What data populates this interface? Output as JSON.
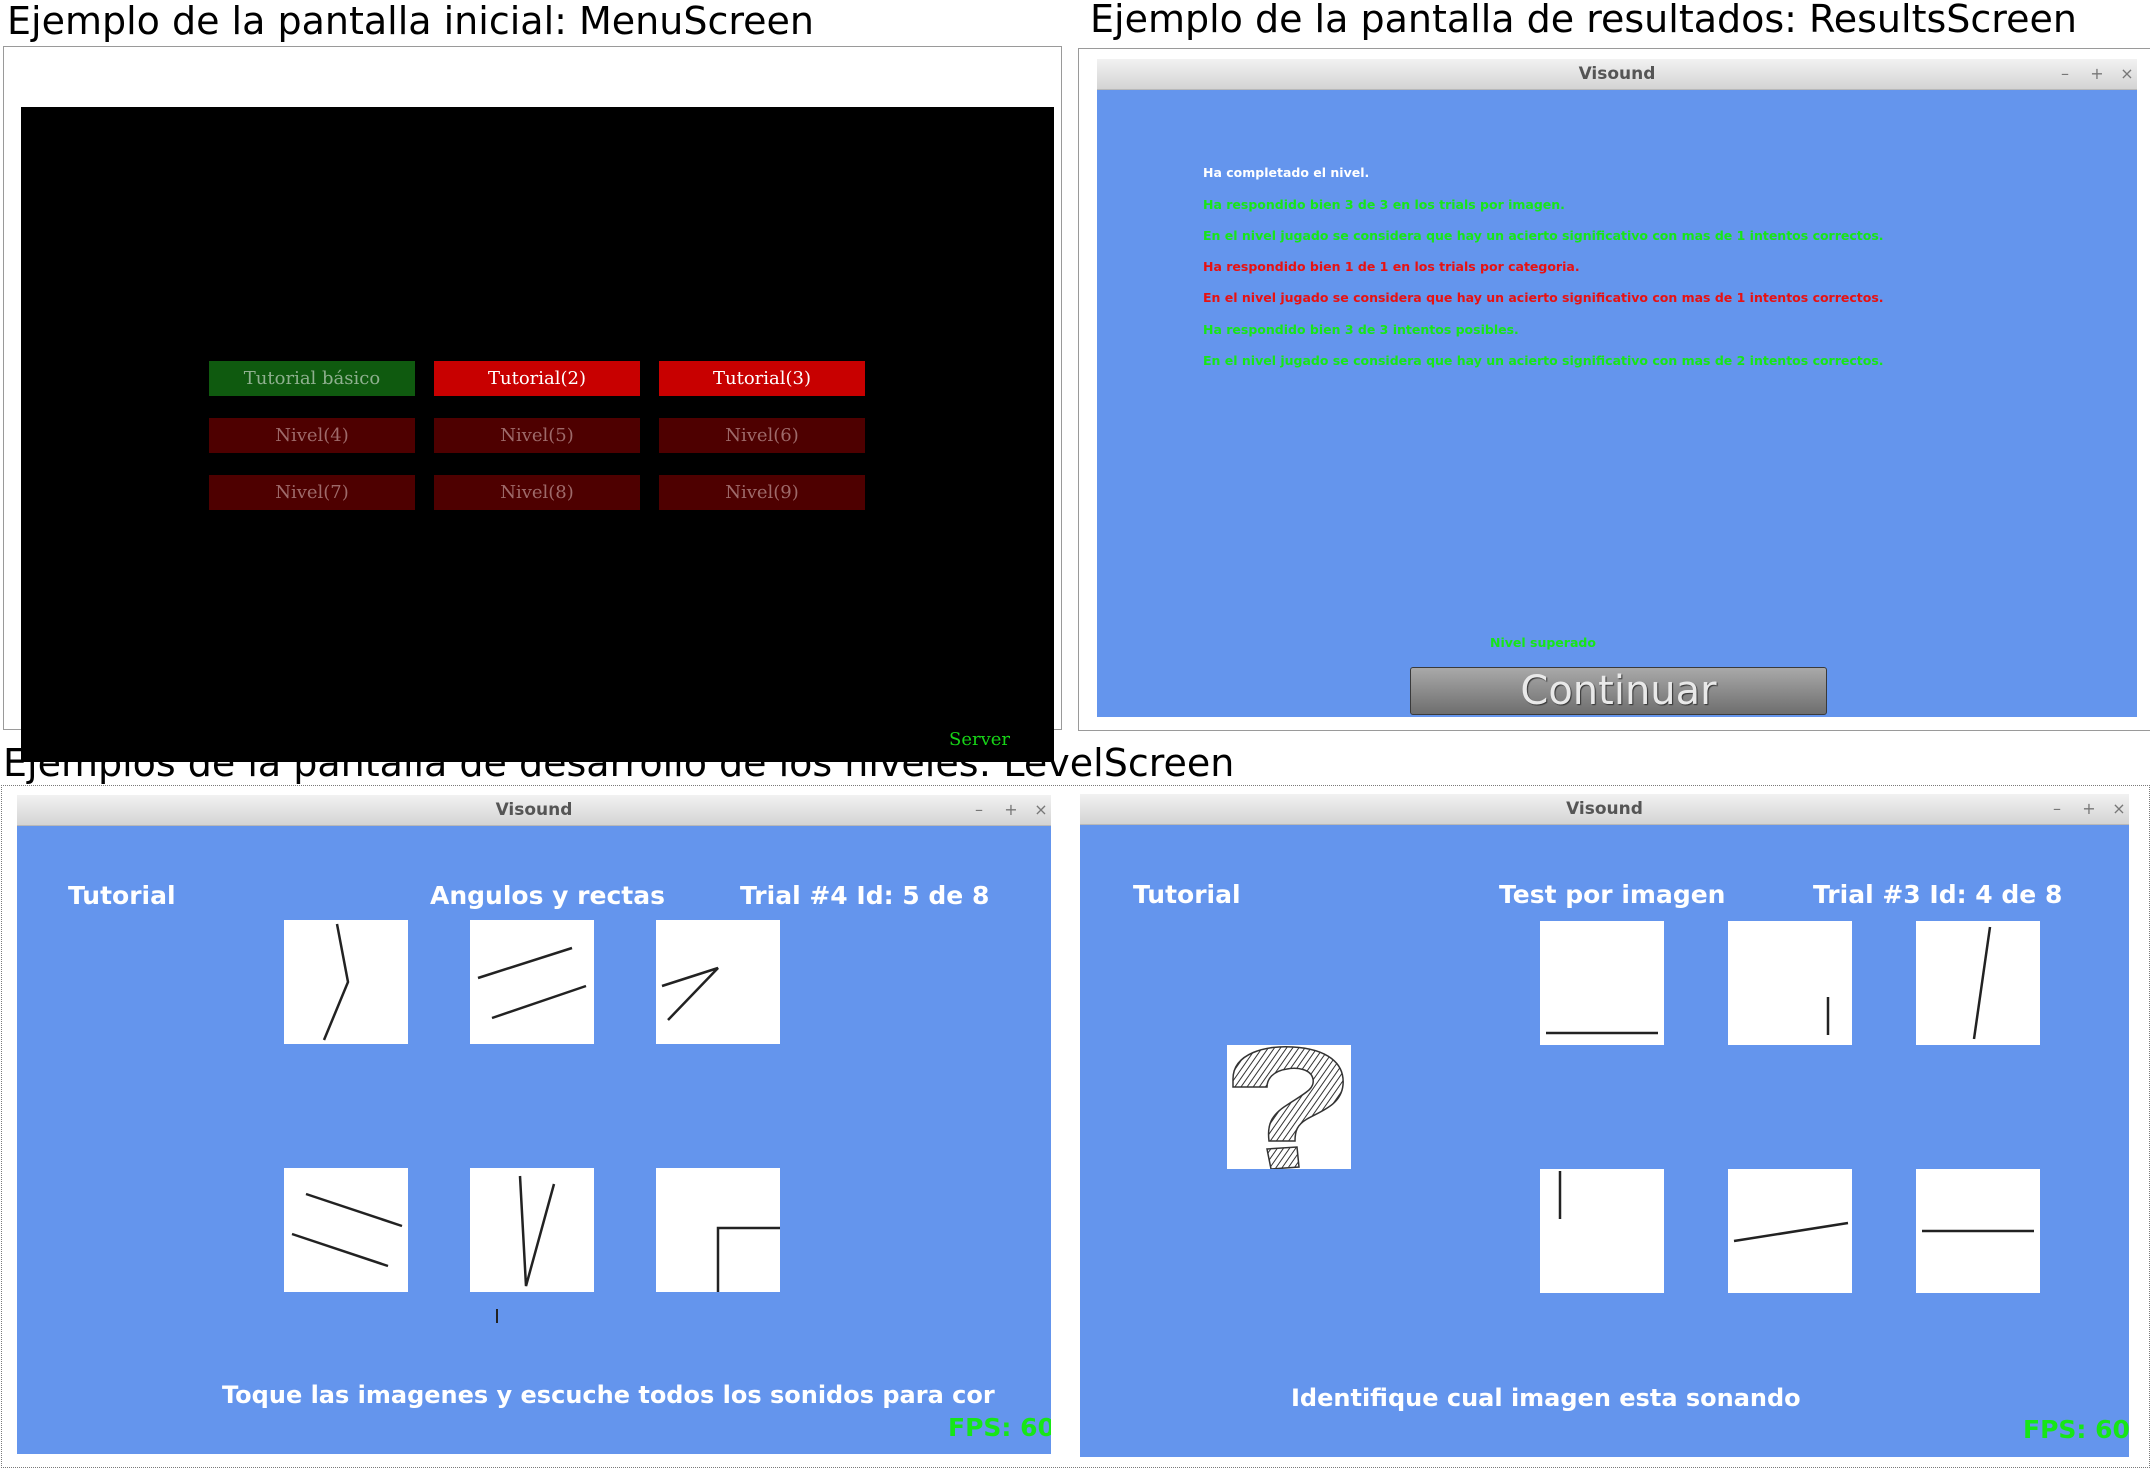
{
  "captions": {
    "menu": "Ejemplo de la pantalla inicial: MenuScreen",
    "results": "Ejemplo de la pantalla de resultados: ResultsScreen",
    "levels": "Ejemplos de la pantalla de desarrollo de los niveles: LevelScreen"
  },
  "menu_screen": {
    "buttons": [
      {
        "label": "Tutorial básico",
        "state": "selected"
      },
      {
        "label": "Tutorial(2)",
        "state": "enabled"
      },
      {
        "label": "Tutorial(3)",
        "state": "enabled"
      },
      {
        "label": "Nivel(4)",
        "state": "locked"
      },
      {
        "label": "Nivel(5)",
        "state": "locked"
      },
      {
        "label": "Nivel(6)",
        "state": "locked"
      },
      {
        "label": "Nivel(7)",
        "state": "locked"
      },
      {
        "label": "Nivel(8)",
        "state": "locked"
      },
      {
        "label": "Nivel(9)",
        "state": "locked"
      }
    ],
    "server_label": "Server"
  },
  "results_screen": {
    "window_title": "Visound",
    "controls": {
      "minimize": "–",
      "maximize": "+",
      "close": "×"
    },
    "lines": [
      {
        "text": "Ha completado el nivel.",
        "color": "white"
      },
      {
        "text": "Ha respondido bien 3 de 3 en los trials por imagen.",
        "color": "green"
      },
      {
        "text": "En el nivel jugado se considera que hay un acierto significativo con mas de 1 intentos correctos.",
        "color": "green"
      },
      {
        "text": "Ha respondido bien 1 de 1 en los trials por categoria.",
        "color": "red"
      },
      {
        "text": "En el nivel jugado se considera que hay un acierto significativo con mas de 1 intentos correctos.",
        "color": "red"
      },
      {
        "text": "Ha respondido bien 3 de 3 intentos posibles.",
        "color": "green"
      },
      {
        "text": "En el nivel jugado se considera que hay un acierto significativo con mas de 2 intentos correctos.",
        "color": "green"
      }
    ],
    "status": "Nivel superado",
    "continue_label": "Continuar"
  },
  "level_screen_1": {
    "window_title": "Visound",
    "controls": {
      "minimize": "–",
      "maximize": "+",
      "close": "×"
    },
    "mode": "Tutorial",
    "level_name": "Angulos y rectas",
    "trial": "Trial #4 Id: 5 de 8",
    "instruction": "Toque las imagenes y escuche todos los sonidos para cor",
    "fps": "FPS: 60",
    "tiles": [
      "angle-bent-line",
      "two-parallel-lines",
      "acute-angle",
      "two-descending-lines",
      "narrow-v-angle",
      "right-angle-corner"
    ]
  },
  "level_screen_2": {
    "window_title": "Visound",
    "controls": {
      "minimize": "–",
      "maximize": "+",
      "close": "×"
    },
    "mode": "Tutorial",
    "level_name": "Test por imagen",
    "trial": "Trial #3 Id: 4 de 8",
    "instruction": "Identifique cual imagen esta sonando",
    "fps": "FPS: 60",
    "query_icon": "question-mark-icon",
    "tiles": [
      "horizontal-bottom-line",
      "short-vertical-line",
      "tilted-vertical-line",
      "short-vertical-top-line",
      "slanted-line",
      "horizontal-line"
    ]
  },
  "colors": {
    "window_bg": "#6495ed",
    "menu_bg": "#000000",
    "selected_button": "#0f5a0f",
    "enabled_button": "#c80000",
    "locked_button": "#4e0000",
    "success_text": "#17e617",
    "error_text": "#e81111"
  }
}
